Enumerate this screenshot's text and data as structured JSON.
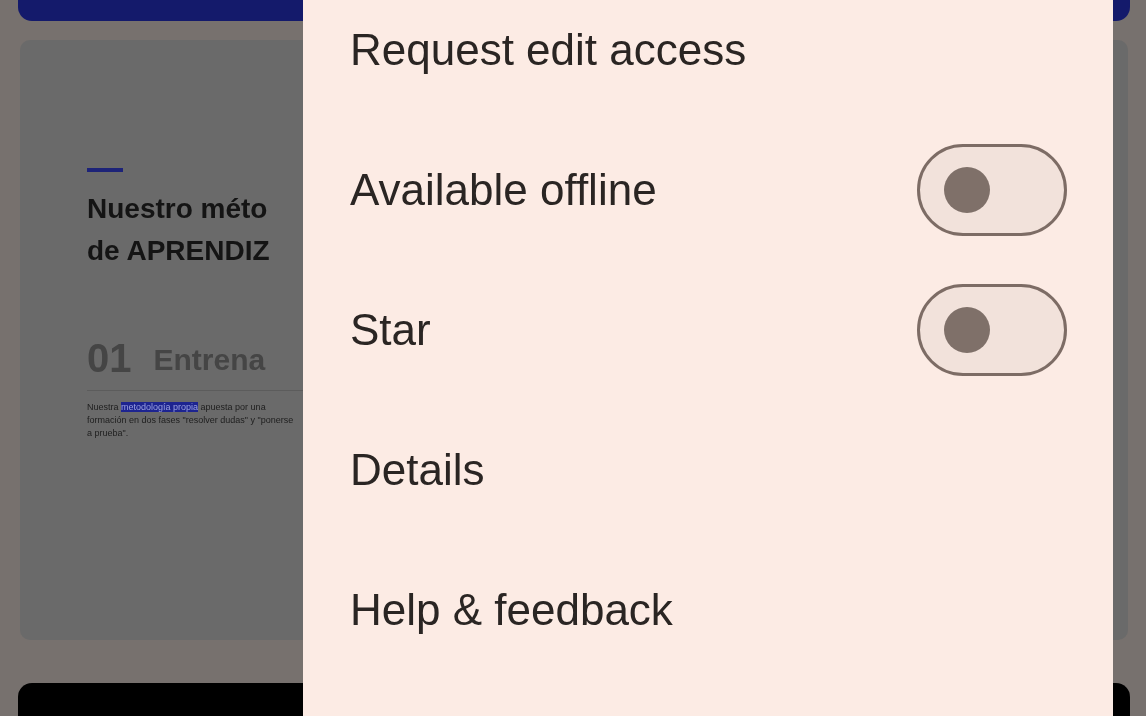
{
  "page": {
    "heading_line_1": "Nuestro méto",
    "heading_line_2": "de APRENDIZ",
    "step_number": "01",
    "step_title": "Entrena",
    "body_before": "Nuestra ",
    "body_highlight": "metodología propia",
    "body_after": " apuesta por una formación en dos fases \"resolver dudas\" y \"ponerse a prueba\"."
  },
  "menu": {
    "items": [
      {
        "kind": "action",
        "label": "Request edit access"
      },
      {
        "kind": "toggle",
        "label": "Available offline",
        "on": false
      },
      {
        "kind": "toggle",
        "label": "Star",
        "on": false
      },
      {
        "kind": "action",
        "label": "Details"
      },
      {
        "kind": "action",
        "label": "Help & feedback"
      }
    ]
  }
}
